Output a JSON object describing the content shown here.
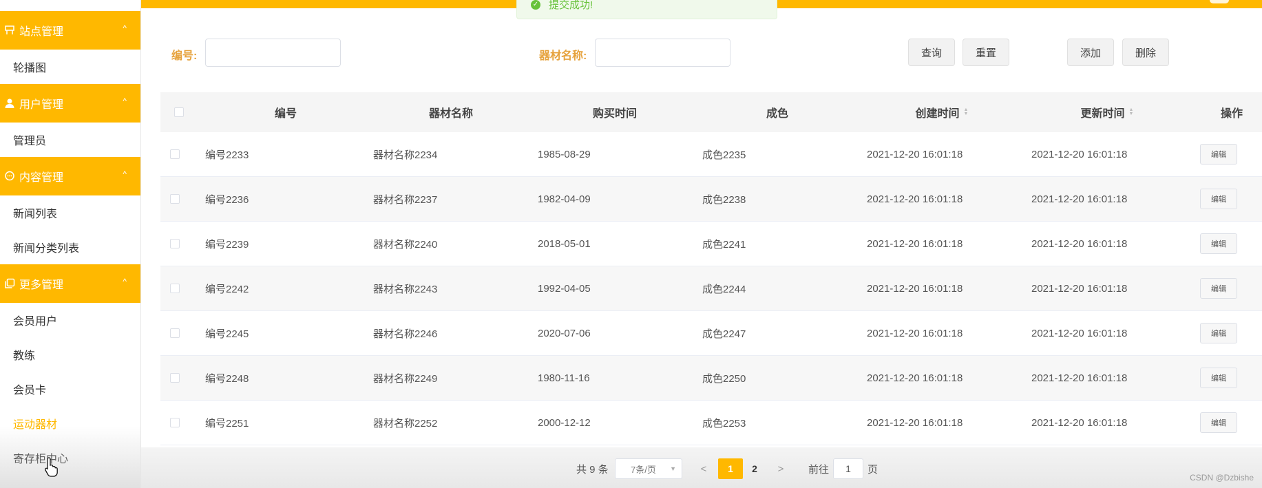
{
  "sidebar": {
    "groups": [
      {
        "label": "站点管理",
        "icon": "storefront-icon"
      },
      {
        "label": "用户管理",
        "icon": "user-icon"
      },
      {
        "label": "内容管理",
        "icon": "chat-bubble-icon"
      },
      {
        "label": "更多管理",
        "icon": "copy-icon"
      }
    ],
    "items": [
      {
        "label": "轮播图"
      },
      {
        "label": "管理员"
      },
      {
        "label": "新闻列表"
      },
      {
        "label": "新闻分类列表"
      },
      {
        "label": "会员用户"
      },
      {
        "label": "教练"
      },
      {
        "label": "会员卡"
      },
      {
        "label": "运动器材"
      },
      {
        "label": "寄存柜中心"
      }
    ],
    "active_item": "运动器材",
    "chevron": "^"
  },
  "toast": {
    "text": "提交成功!",
    "icon": "check-circle-icon"
  },
  "search": {
    "code_label": "编号:",
    "code_value": "",
    "name_label": "器材名称:",
    "name_value": "",
    "query_label": "查询",
    "reset_label": "重置",
    "add_label": "添加",
    "delete_label": "删除"
  },
  "table": {
    "columns": [
      "编号",
      "器材名称",
      "购买时间",
      "成色",
      "创建时间",
      "更新时间",
      "操作"
    ],
    "edit_label": "编辑",
    "rows": [
      {
        "code": "编号2233",
        "name": "器材名称2234",
        "purchase": "1985-08-29",
        "condition": "成色2235",
        "created": "2021-12-20 16:01:18",
        "updated": "2021-12-20 16:01:18"
      },
      {
        "code": "编号2236",
        "name": "器材名称2237",
        "purchase": "1982-04-09",
        "condition": "成色2238",
        "created": "2021-12-20 16:01:18",
        "updated": "2021-12-20 16:01:18"
      },
      {
        "code": "编号2239",
        "name": "器材名称2240",
        "purchase": "2018-05-01",
        "condition": "成色2241",
        "created": "2021-12-20 16:01:18",
        "updated": "2021-12-20 16:01:18"
      },
      {
        "code": "编号2242",
        "name": "器材名称2243",
        "purchase": "1992-04-05",
        "condition": "成色2244",
        "created": "2021-12-20 16:01:18",
        "updated": "2021-12-20 16:01:18"
      },
      {
        "code": "编号2245",
        "name": "器材名称2246",
        "purchase": "2020-07-06",
        "condition": "成色2247",
        "created": "2021-12-20 16:01:18",
        "updated": "2021-12-20 16:01:18"
      },
      {
        "code": "编号2248",
        "name": "器材名称2249",
        "purchase": "1980-11-16",
        "condition": "成色2250",
        "created": "2021-12-20 16:01:18",
        "updated": "2021-12-20 16:01:18"
      },
      {
        "code": "编号2251",
        "name": "器材名称2252",
        "purchase": "2000-12-12",
        "condition": "成色2253",
        "created": "2021-12-20 16:01:18",
        "updated": "2021-12-20 16:01:18"
      }
    ]
  },
  "pagination": {
    "total_text": "共 9 条",
    "page_size": "7条/页",
    "prev": "<",
    "next": ">",
    "pages": [
      "1",
      "2"
    ],
    "current_page": "1",
    "goto_label": "前往",
    "goto_value": "1",
    "page_suffix": "页"
  },
  "watermark": "CSDN @Dzbishe",
  "colors": {
    "accent": "#ffb800",
    "label": "#e6a23c",
    "success": "#67c23a"
  }
}
